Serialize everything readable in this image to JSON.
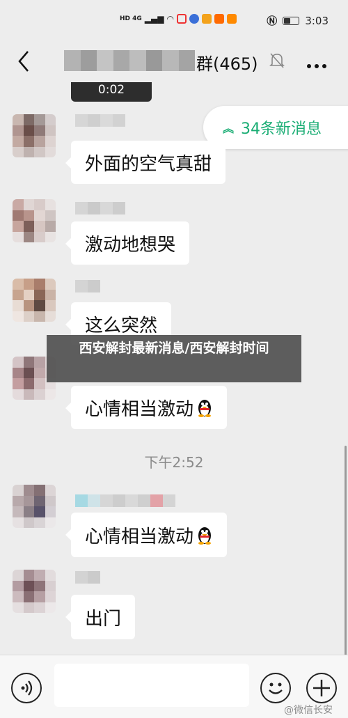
{
  "status_bar": {
    "network": "HD 4G",
    "time": "3:03"
  },
  "header": {
    "title": "群(465)",
    "back_icon": "chevron-left-icon",
    "mute_icon": "bell-muted-icon",
    "more_icon": "ellipsis-icon"
  },
  "video_chip": {
    "duration": "0:02"
  },
  "new_messages": {
    "label": "34条新消息",
    "icon": "double-chevron-up-icon",
    "color": "#1aad74"
  },
  "messages": [
    {
      "text": "外面的空气真甜",
      "emoji": ""
    },
    {
      "text": "激动地想哭",
      "emoji": ""
    },
    {
      "text": "这么突然",
      "emoji": ""
    },
    {
      "text": "心情相当激动",
      "emoji": "qq-penguin-icon"
    },
    {
      "text": "心情相当激动",
      "emoji": "qq-penguin-icon"
    },
    {
      "text": "出门",
      "emoji": ""
    }
  ],
  "time_separator": "下午2:52",
  "overlay": {
    "headline": "西安解封最新消息/西安解封时间"
  },
  "input_bar": {
    "voice_icon": "voice-icon",
    "emoji_icon": "smiley-icon",
    "plus_icon": "plus-icon",
    "watermark": "@微信长安"
  }
}
